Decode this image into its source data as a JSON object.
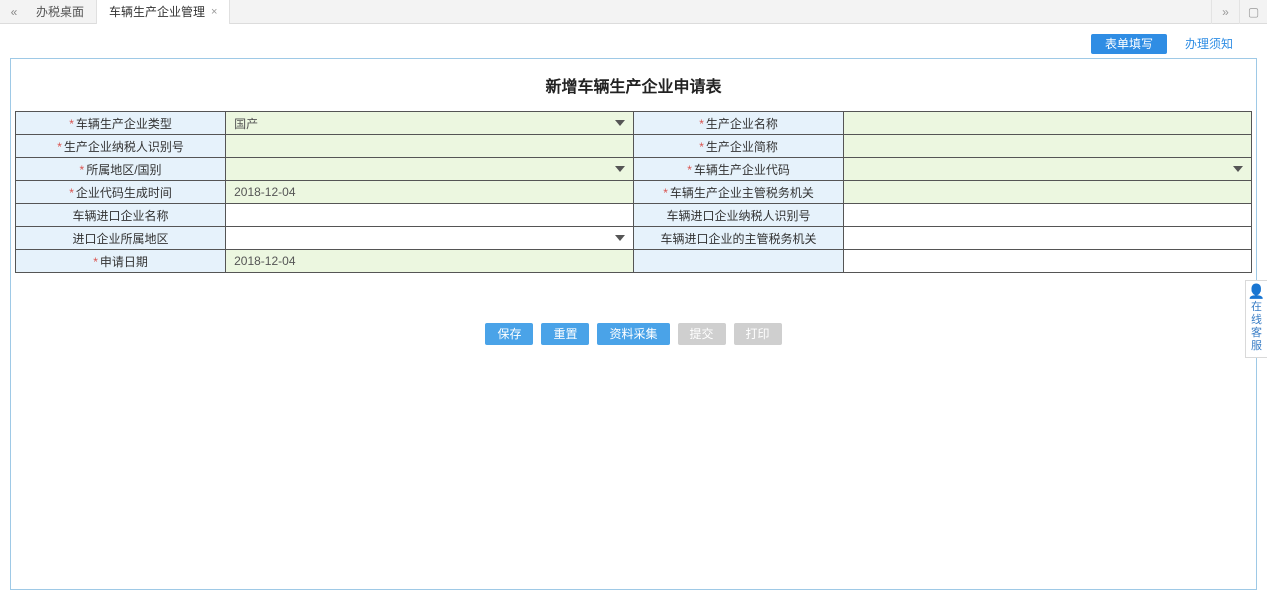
{
  "tabs": {
    "desktop": "办税桌面",
    "mgmt": "车辆生产企业管理"
  },
  "actions": {
    "fill": "表单填写",
    "notice": "办理须知"
  },
  "title": "新增车辆生产企业申请表",
  "labels": {
    "enterpriseType": "车辆生产企业类型",
    "enterpriseName": "生产企业名称",
    "taxId": "生产企业纳税人识别号",
    "shortName": "生产企业简称",
    "region": "所属地区/国别",
    "enterpriseCode": "车辆生产企业代码",
    "codeGenTime": "企业代码生成时间",
    "taxAuthority": "车辆生产企业主管税务机关",
    "importName": "车辆进口企业名称",
    "importTaxId": "车辆进口企业纳税人识别号",
    "importRegion": "进口企业所属地区",
    "importAuthority": "车辆进口企业的主管税务机关",
    "applyDate": "申请日期"
  },
  "values": {
    "enterpriseType": "国产",
    "codeGenTime": "2018-12-04",
    "applyDate": "2018-12-04"
  },
  "buttons": {
    "save": "保存",
    "reset": "重置",
    "collect": "资料采集",
    "submit": "提交",
    "print": "打印"
  },
  "side": {
    "line1": "在线",
    "line2": "客服"
  }
}
